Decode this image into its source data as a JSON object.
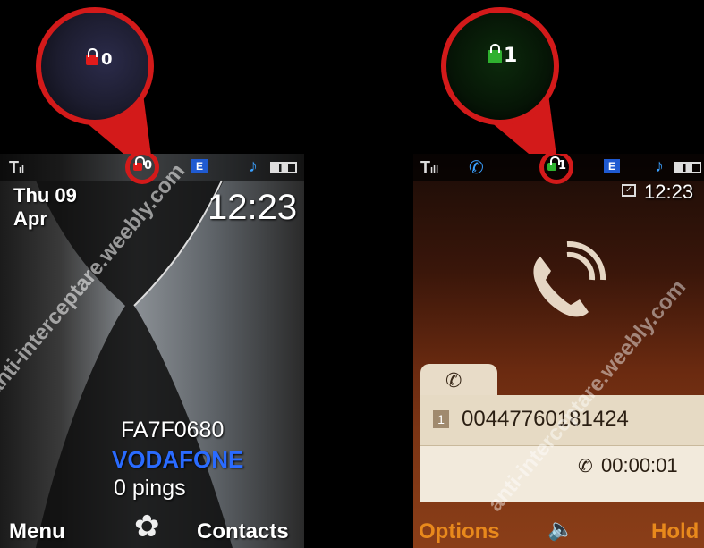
{
  "left_phone": {
    "zoom_lock_number": "0",
    "status_lock_number": "0",
    "date_line1": "Thu 09",
    "date_line2": "Apr",
    "time": "12:23",
    "cipher_code": "FA7F0680",
    "operator": "VODAFONE",
    "pings": "0 pings",
    "softkey_left": "Menu",
    "softkey_right": "Contacts",
    "icons": [
      "signal-icon",
      "red-padlock-icon",
      "e-icon",
      "music-note-icon",
      "battery-icon",
      "menu-flower-icon"
    ]
  },
  "right_phone": {
    "zoom_lock_number": "1",
    "status_lock_number": "1",
    "time": "12:23",
    "call_slot": "1",
    "number": "00447760181424",
    "duration": "00:00:01",
    "softkey_left": "Options",
    "softkey_right": "Hold",
    "icons": [
      "signal-icon",
      "phone-handset-icon",
      "green-padlock-icon",
      "e-icon",
      "music-note-icon",
      "battery-icon",
      "alarm-icon",
      "speaker-icon"
    ]
  },
  "watermark": "anti-interceptare.weebly.com",
  "colors": {
    "ring_red": "#d31a1a",
    "lock_red": "#e11b1b",
    "lock_green": "#2fb12f",
    "operator_blue": "#2a6bff",
    "softkey_orange": "#e8891c"
  }
}
